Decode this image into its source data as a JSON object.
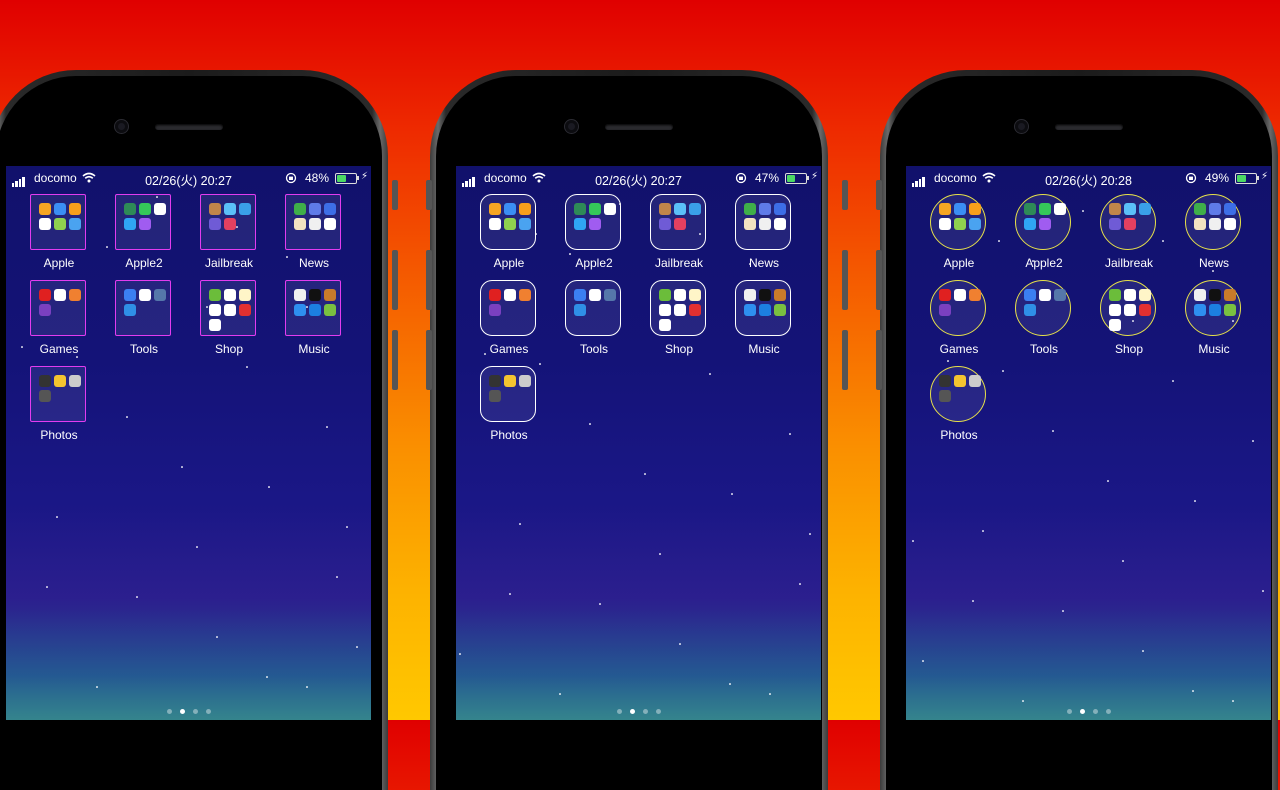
{
  "phones": [
    {
      "status": {
        "carrier": "docomo",
        "time": "02/26(火) 20:27",
        "battery_pct": "48%",
        "battery_level": 0.48
      },
      "folders": [
        {
          "label": "Apple",
          "icons": [
            "#f6a623",
            "#3b8ef3",
            "#f7a01b",
            "#ffffff",
            "#8fd14f",
            "#4aa3f0"
          ]
        },
        {
          "label": "Apple2",
          "icons": [
            "#2e8b57",
            "#35c759",
            "#ffffff",
            "#2fa6f4",
            "#a05cf0"
          ]
        },
        {
          "label": "Jailbreak",
          "icons": [
            "#c0864a",
            "#5bc0f8",
            "#3aa0e8",
            "#6f5bd6",
            "#e34060"
          ]
        },
        {
          "label": "News",
          "icons": [
            "#3fae49",
            "#5f7be8",
            "#3d6ee6",
            "#f4e3c0",
            "#f0f0f0",
            "#ffffff"
          ]
        },
        {
          "label": "Games",
          "icons": [
            "#e02020",
            "#ffffff",
            "#f08030",
            "#7a40c0"
          ]
        },
        {
          "label": "Tools",
          "icons": [
            "#3b7ff2",
            "#ffffff",
            "#5577aa",
            "#2f8fe6"
          ]
        },
        {
          "label": "Shop",
          "icons": [
            "#6bbd3a",
            "#ffffff",
            "#fff5c8",
            "#ffffff",
            "#ffffff",
            "#e23030",
            "#ffffff"
          ]
        },
        {
          "label": "Music",
          "icons": [
            "#f0f0f0",
            "#111111",
            "#c87b2a",
            "#2e8ff0",
            "#1c7fe0",
            "#7ac040"
          ]
        },
        {
          "label": "Photos",
          "icons": [
            "#333333",
            "#f4c430",
            "#cccccc",
            "#555555"
          ]
        }
      ]
    },
    {
      "status": {
        "carrier": "docomo",
        "time": "02/26(火) 20:27",
        "battery_pct": "47%",
        "battery_level": 0.47
      },
      "folders": [
        {
          "label": "Apple",
          "icons": [
            "#f6a623",
            "#3b8ef3",
            "#f7a01b",
            "#ffffff",
            "#8fd14f",
            "#4aa3f0"
          ]
        },
        {
          "label": "Apple2",
          "icons": [
            "#2e8b57",
            "#35c759",
            "#ffffff",
            "#2fa6f4",
            "#a05cf0"
          ]
        },
        {
          "label": "Jailbreak",
          "icons": [
            "#c0864a",
            "#5bc0f8",
            "#3aa0e8",
            "#6f5bd6",
            "#e34060"
          ]
        },
        {
          "label": "News",
          "icons": [
            "#3fae49",
            "#5f7be8",
            "#3d6ee6",
            "#f4e3c0",
            "#f0f0f0",
            "#ffffff"
          ]
        },
        {
          "label": "Games",
          "icons": [
            "#e02020",
            "#ffffff",
            "#f08030",
            "#7a40c0"
          ]
        },
        {
          "label": "Tools",
          "icons": [
            "#3b7ff2",
            "#ffffff",
            "#5577aa",
            "#2f8fe6"
          ]
        },
        {
          "label": "Shop",
          "icons": [
            "#6bbd3a",
            "#ffffff",
            "#fff5c8",
            "#ffffff",
            "#ffffff",
            "#e23030",
            "#ffffff"
          ]
        },
        {
          "label": "Music",
          "icons": [
            "#f0f0f0",
            "#111111",
            "#c87b2a",
            "#2e8ff0",
            "#1c7fe0",
            "#7ac040"
          ]
        },
        {
          "label": "Photos",
          "icons": [
            "#333333",
            "#f4c430",
            "#cccccc",
            "#555555"
          ]
        }
      ]
    },
    {
      "status": {
        "carrier": "docomo",
        "time": "02/26(火) 20:28",
        "battery_pct": "49%",
        "battery_level": 0.49
      },
      "folders": [
        {
          "label": "Apple",
          "icons": [
            "#f6a623",
            "#3b8ef3",
            "#f7a01b",
            "#ffffff",
            "#8fd14f",
            "#4aa3f0"
          ]
        },
        {
          "label": "Apple2",
          "icons": [
            "#2e8b57",
            "#35c759",
            "#ffffff",
            "#2fa6f4",
            "#a05cf0"
          ]
        },
        {
          "label": "Jailbreak",
          "icons": [
            "#c0864a",
            "#5bc0f8",
            "#3aa0e8",
            "#6f5bd6",
            "#e34060"
          ]
        },
        {
          "label": "News",
          "icons": [
            "#3fae49",
            "#5f7be8",
            "#3d6ee6",
            "#f4e3c0",
            "#f0f0f0",
            "#ffffff"
          ]
        },
        {
          "label": "Games",
          "icons": [
            "#e02020",
            "#ffffff",
            "#f08030",
            "#7a40c0"
          ]
        },
        {
          "label": "Tools",
          "icons": [
            "#3b7ff2",
            "#ffffff",
            "#5577aa",
            "#2f8fe6"
          ]
        },
        {
          "label": "Shop",
          "icons": [
            "#6bbd3a",
            "#ffffff",
            "#fff5c8",
            "#ffffff",
            "#ffffff",
            "#e23030",
            "#ffffff"
          ]
        },
        {
          "label": "Music",
          "icons": [
            "#f0f0f0",
            "#111111",
            "#c87b2a",
            "#2e8ff0",
            "#1c7fe0",
            "#7ac040"
          ]
        },
        {
          "label": "Photos",
          "icons": [
            "#333333",
            "#f4c430",
            "#cccccc",
            "#555555"
          ]
        }
      ]
    }
  ],
  "page_dots": {
    "count": 4,
    "active": 1
  },
  "colors": {
    "folder_outline_1": "#e23cf0",
    "folder_outline_2": "#ffffff",
    "folder_outline_3": "#e6e04a"
  }
}
